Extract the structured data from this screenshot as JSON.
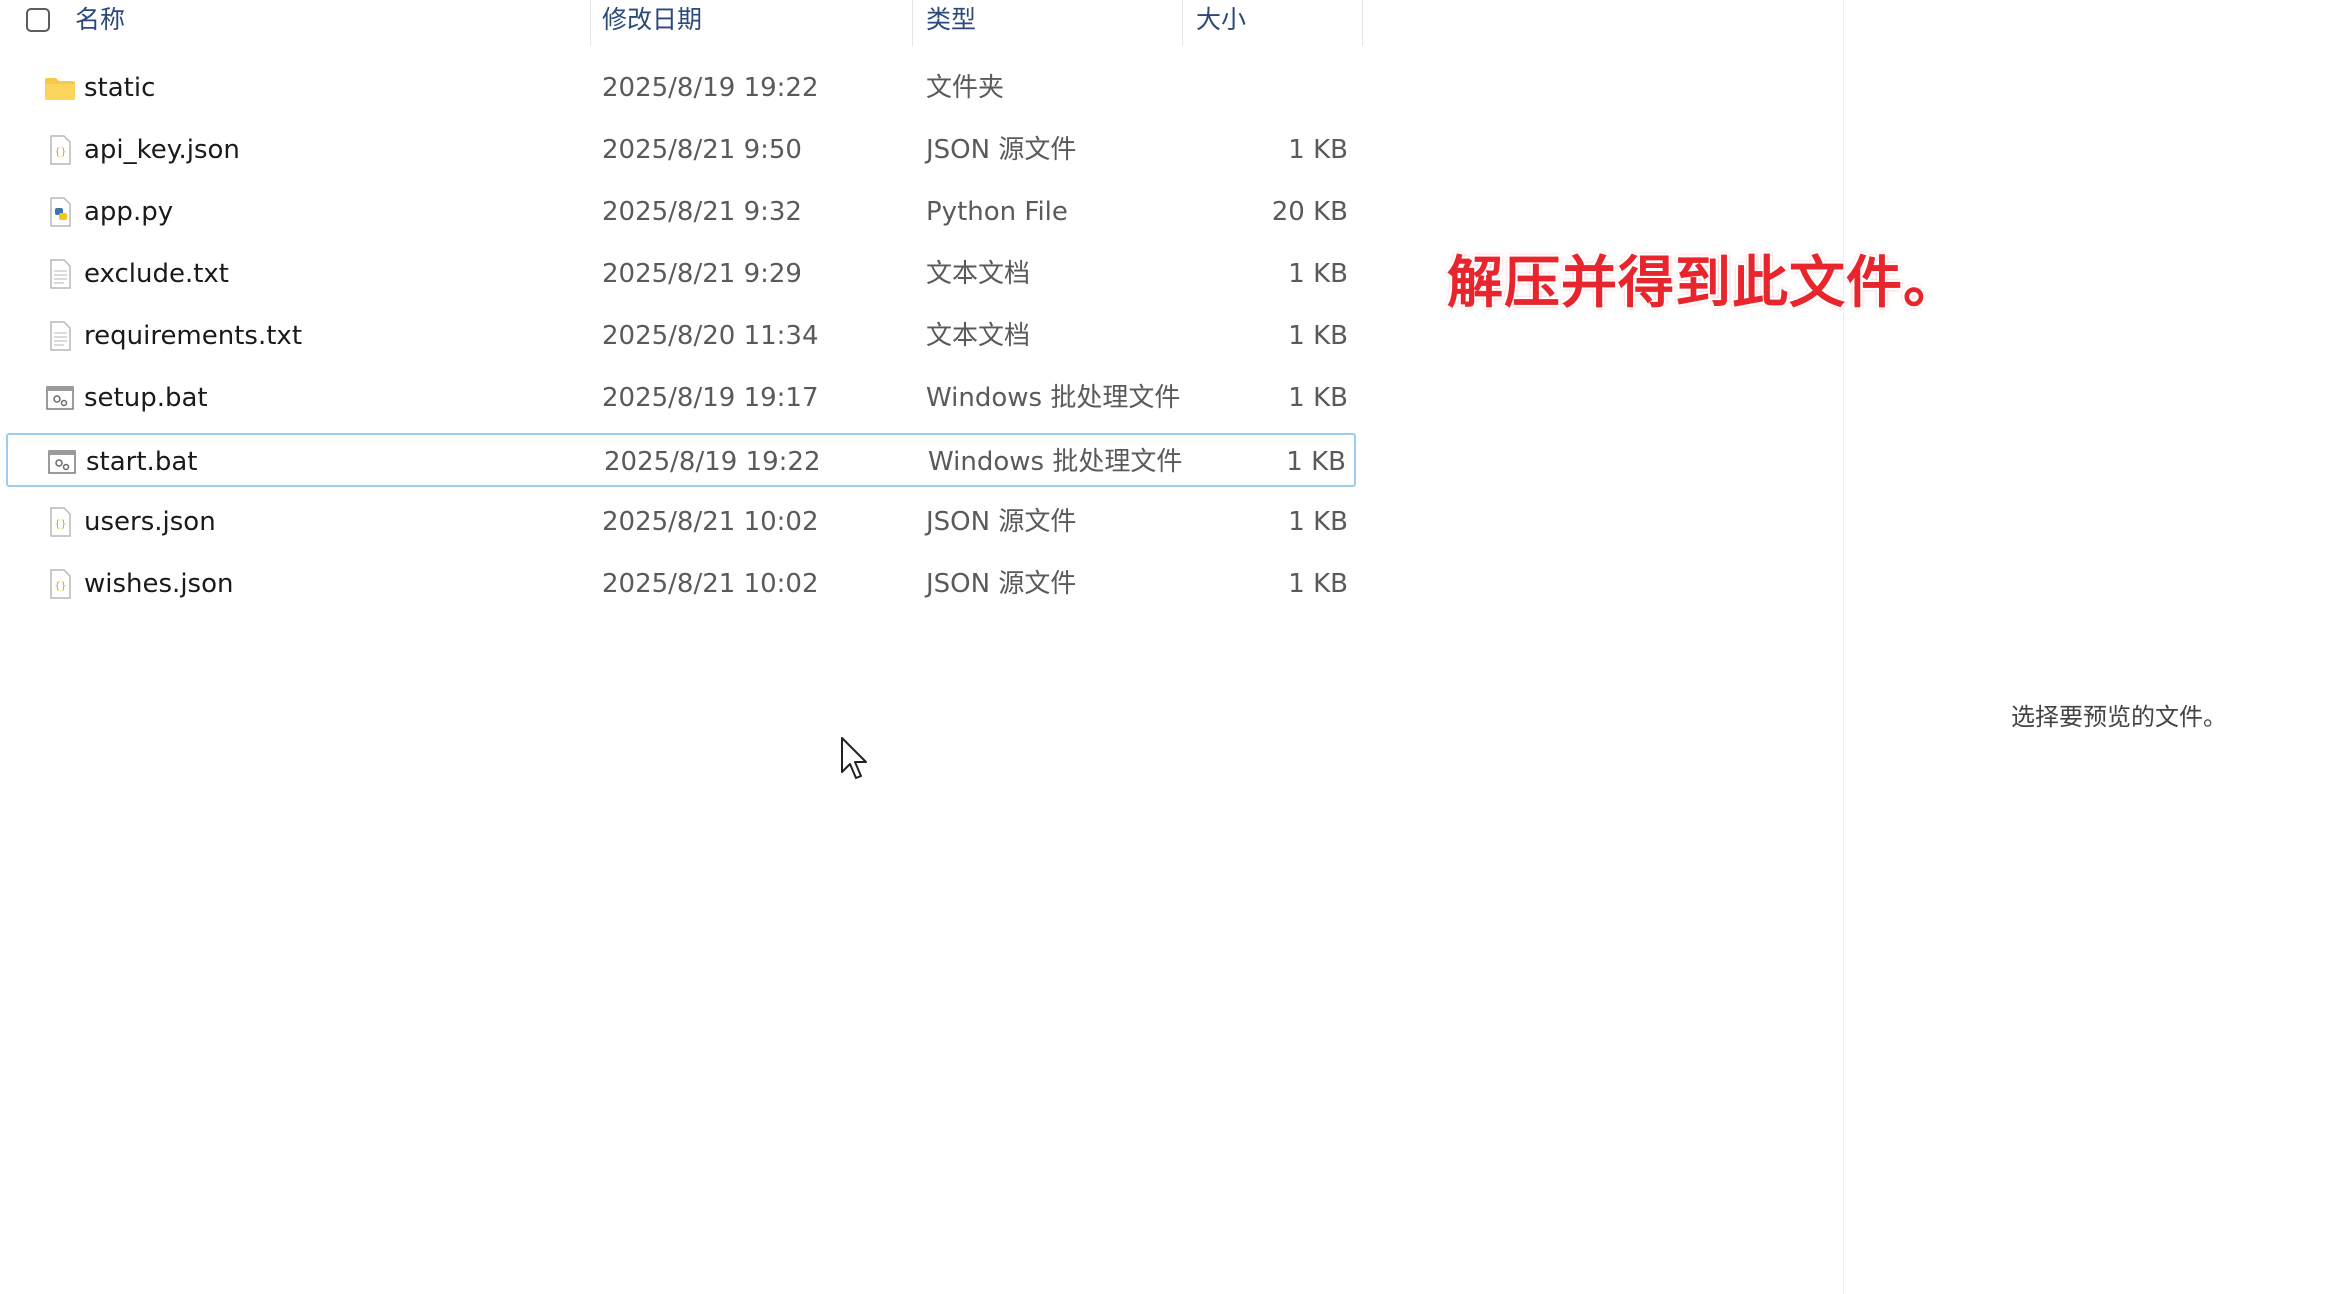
{
  "header": {
    "name": "名称",
    "date": "修改日期",
    "type": "类型",
    "size": "大小"
  },
  "files": [
    {
      "name": "static",
      "date": "2025/8/19 19:22",
      "type": "文件夹",
      "size": "",
      "icon": "folder-icon"
    },
    {
      "name": "api_key.json",
      "date": "2025/8/21 9:50",
      "type": "JSON 源文件",
      "size": "1 KB",
      "icon": "json-file-icon"
    },
    {
      "name": "app.py",
      "date": "2025/8/21 9:32",
      "type": "Python File",
      "size": "20 KB",
      "icon": "python-file-icon"
    },
    {
      "name": "exclude.txt",
      "date": "2025/8/21 9:29",
      "type": "文本文档",
      "size": "1 KB",
      "icon": "text-file-icon"
    },
    {
      "name": "requirements.txt",
      "date": "2025/8/20 11:34",
      "type": "文本文档",
      "size": "1 KB",
      "icon": "text-file-icon"
    },
    {
      "name": "setup.bat",
      "date": "2025/8/19 19:17",
      "type": "Windows 批处理文件",
      "size": "1 KB",
      "icon": "batch-file-icon"
    },
    {
      "name": "start.bat",
      "date": "2025/8/19 19:22",
      "type": "Windows 批处理文件",
      "size": "1 KB",
      "icon": "batch-file-icon",
      "selected": true
    },
    {
      "name": "users.json",
      "date": "2025/8/21 10:02",
      "type": "JSON 源文件",
      "size": "1 KB",
      "icon": "json-file-icon"
    },
    {
      "name": "wishes.json",
      "date": "2025/8/21 10:02",
      "type": "JSON 源文件",
      "size": "1 KB",
      "icon": "json-file-icon"
    }
  ],
  "annotation": "解压并得到此文件。",
  "preview": {
    "message": "选择要预览的文件。"
  },
  "colors": {
    "accent": "#e8242c",
    "selection_border": "#9fcdf0",
    "folder": "#f8c84a"
  }
}
